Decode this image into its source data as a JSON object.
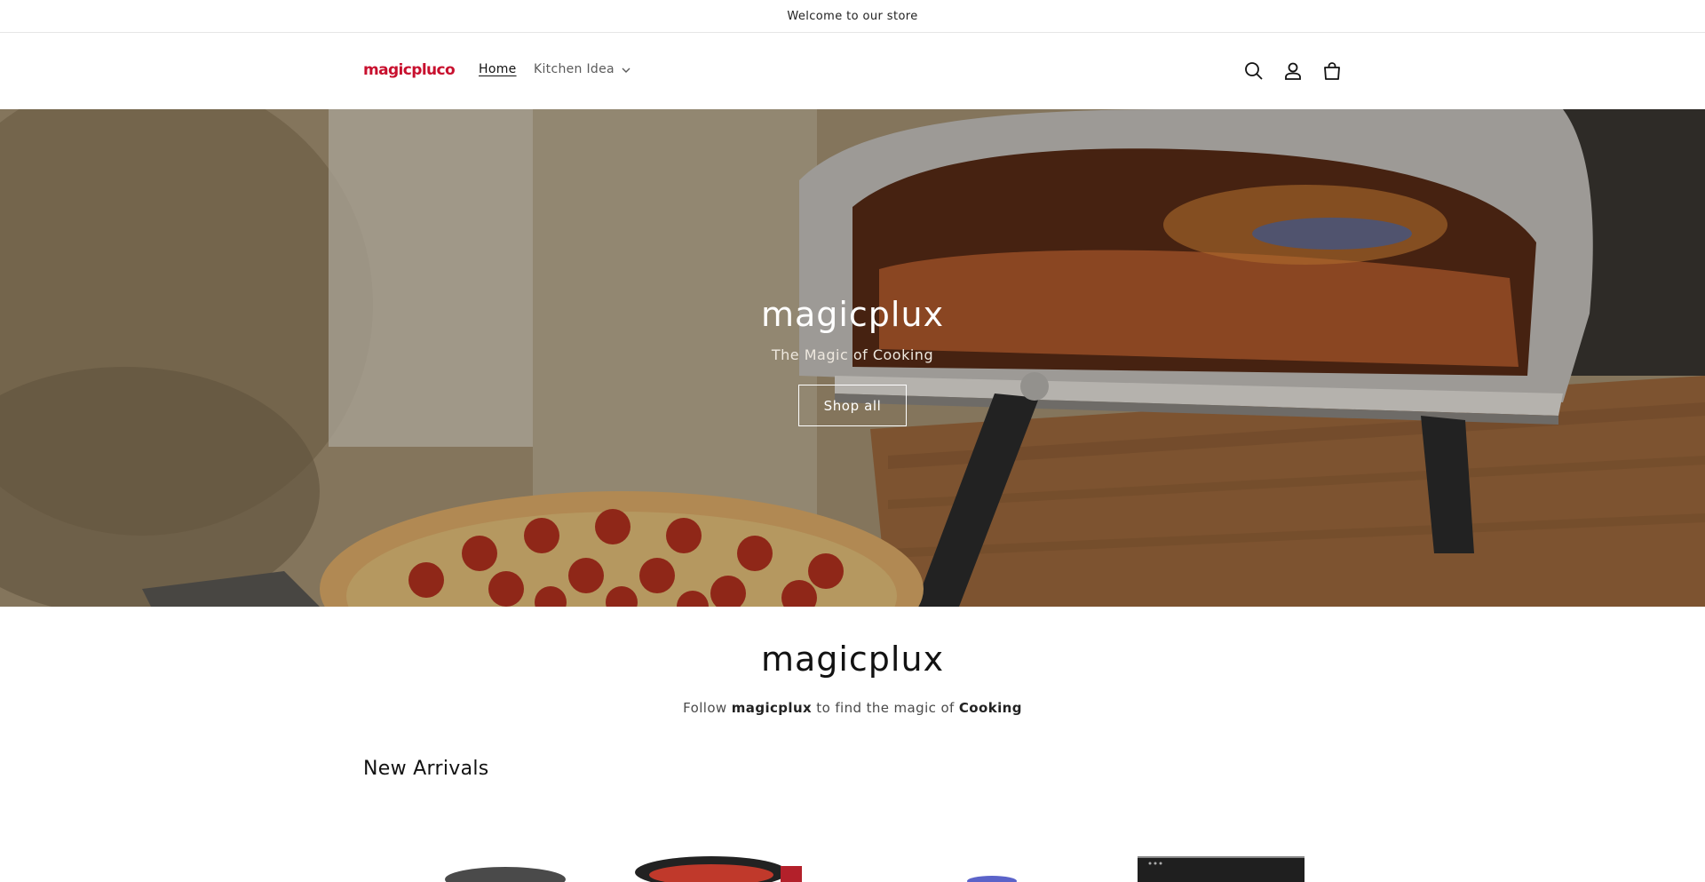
{
  "announcement": {
    "text": "Welcome to our store"
  },
  "header": {
    "logo_text": "magicpluco",
    "nav": {
      "home": "Home",
      "kitchen_idea": "Kitchen Idea"
    },
    "icons": [
      "search-icon",
      "account-icon",
      "cart-icon"
    ]
  },
  "hero": {
    "title": "magicplux",
    "subtitle": "The Magic of Cooking",
    "button_label": "Shop all"
  },
  "intro": {
    "title": "magicplux",
    "text_before": "Follow ",
    "brand": "magicplux",
    "text_middle": " to find the magic of ",
    "keyword": "Cooking"
  },
  "new_arrivals": {
    "title": "New Arrivals",
    "products": [
      {
        "name": "product-pan"
      },
      {
        "name": "product-pot"
      },
      {
        "name": "product-blue-item"
      },
      {
        "name": "product-induction-cooktop"
      }
    ]
  },
  "colors": {
    "logo": "#c8102e",
    "text": "#121212",
    "muted": "#5a5a5a",
    "border": "#e6e6e6"
  }
}
